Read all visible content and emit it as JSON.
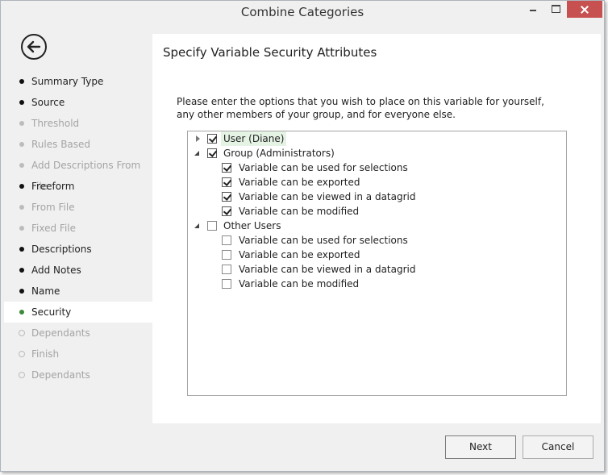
{
  "window": {
    "title": "Combine Categories"
  },
  "sidebar": {
    "steps": [
      {
        "label": "Summary Type",
        "state": "done"
      },
      {
        "label": "Source",
        "state": "done"
      },
      {
        "label": "Threshold",
        "state": "disabled"
      },
      {
        "label": "Rules Based",
        "state": "disabled"
      },
      {
        "label": "Add Descriptions From File",
        "state": "disabled"
      },
      {
        "label": "Freeform",
        "state": "done"
      },
      {
        "label": "From File",
        "state": "disabled"
      },
      {
        "label": "Fixed File",
        "state": "disabled"
      },
      {
        "label": "Descriptions",
        "state": "done"
      },
      {
        "label": "Add Notes",
        "state": "done"
      },
      {
        "label": "Name",
        "state": "done"
      },
      {
        "label": "Security",
        "state": "current"
      },
      {
        "label": "Dependants",
        "state": "pending"
      },
      {
        "label": "Finish",
        "state": "pending"
      },
      {
        "label": "Dependants",
        "state": "pending"
      }
    ]
  },
  "main": {
    "title": "Specify Variable Security Attributes",
    "instructions": "Please enter the options that you wish to place on this variable for yourself, any other members of your group, and for everyone else."
  },
  "tree": {
    "user": {
      "label": "User (Diane)",
      "checked": true,
      "expanded": false
    },
    "group": {
      "label": "Group (Administrators)",
      "checked": true,
      "expanded": true,
      "children": [
        {
          "label": "Variable can be used for selections",
          "checked": true
        },
        {
          "label": "Variable can be exported",
          "checked": true
        },
        {
          "label": "Variable can be viewed in a datagrid",
          "checked": true
        },
        {
          "label": "Variable can be modified",
          "checked": true
        }
      ]
    },
    "other": {
      "label": "Other Users",
      "checked": false,
      "expanded": true,
      "children": [
        {
          "label": "Variable can be used for selections",
          "checked": false
        },
        {
          "label": "Variable can be exported",
          "checked": false
        },
        {
          "label": "Variable can be viewed in a datagrid",
          "checked": false
        },
        {
          "label": "Variable can be modified",
          "checked": false
        }
      ]
    }
  },
  "footer": {
    "next_label": "Next",
    "cancel_label": "Cancel"
  },
  "colors": {
    "current_step_dot": "#3b8a3b",
    "close_button": "#c75050",
    "selected_node": "#e5f3e5"
  },
  "icons": {
    "back": "back-arrow-circle-icon"
  }
}
